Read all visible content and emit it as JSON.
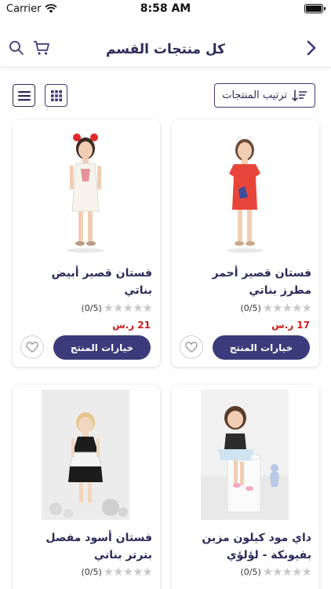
{
  "status_bar": {
    "carrier": "Carrier",
    "time": "8:58 AM"
  },
  "nav": {
    "title": "كل منتجات القسم",
    "icons": [
      "search-icon",
      "cart-icon",
      "chevron-right-icon"
    ]
  },
  "toolbar": {
    "sort_label": "ترتيب المنتجات",
    "view_modes": [
      "list",
      "grid"
    ]
  },
  "colors": {
    "primary": "#3b3a7a",
    "price": "#d21a1a",
    "star": "#c9c9c9"
  },
  "products": [
    {
      "name": "فستان قصير أحمر مطرز بناتي",
      "rating": "(0/5)",
      "price": "17 ر.س",
      "options_label": "خيارات المنتج",
      "image": "girl-red-dress"
    },
    {
      "name": "فستان قصير أبيض بناتي",
      "rating": "(0/5)",
      "price": "21 ر.س",
      "options_label": "خيارات المنتج",
      "image": "girl-white-dress"
    },
    {
      "name": "داي مود كيلون مزين بفيونكة - لؤلؤي",
      "rating": "(0/5)",
      "image": "girl-tutu-dress"
    },
    {
      "name": "فستان أسود مفصل بترتر بناتي",
      "rating": "(0/5)",
      "image": "toddler-black-dress"
    }
  ]
}
